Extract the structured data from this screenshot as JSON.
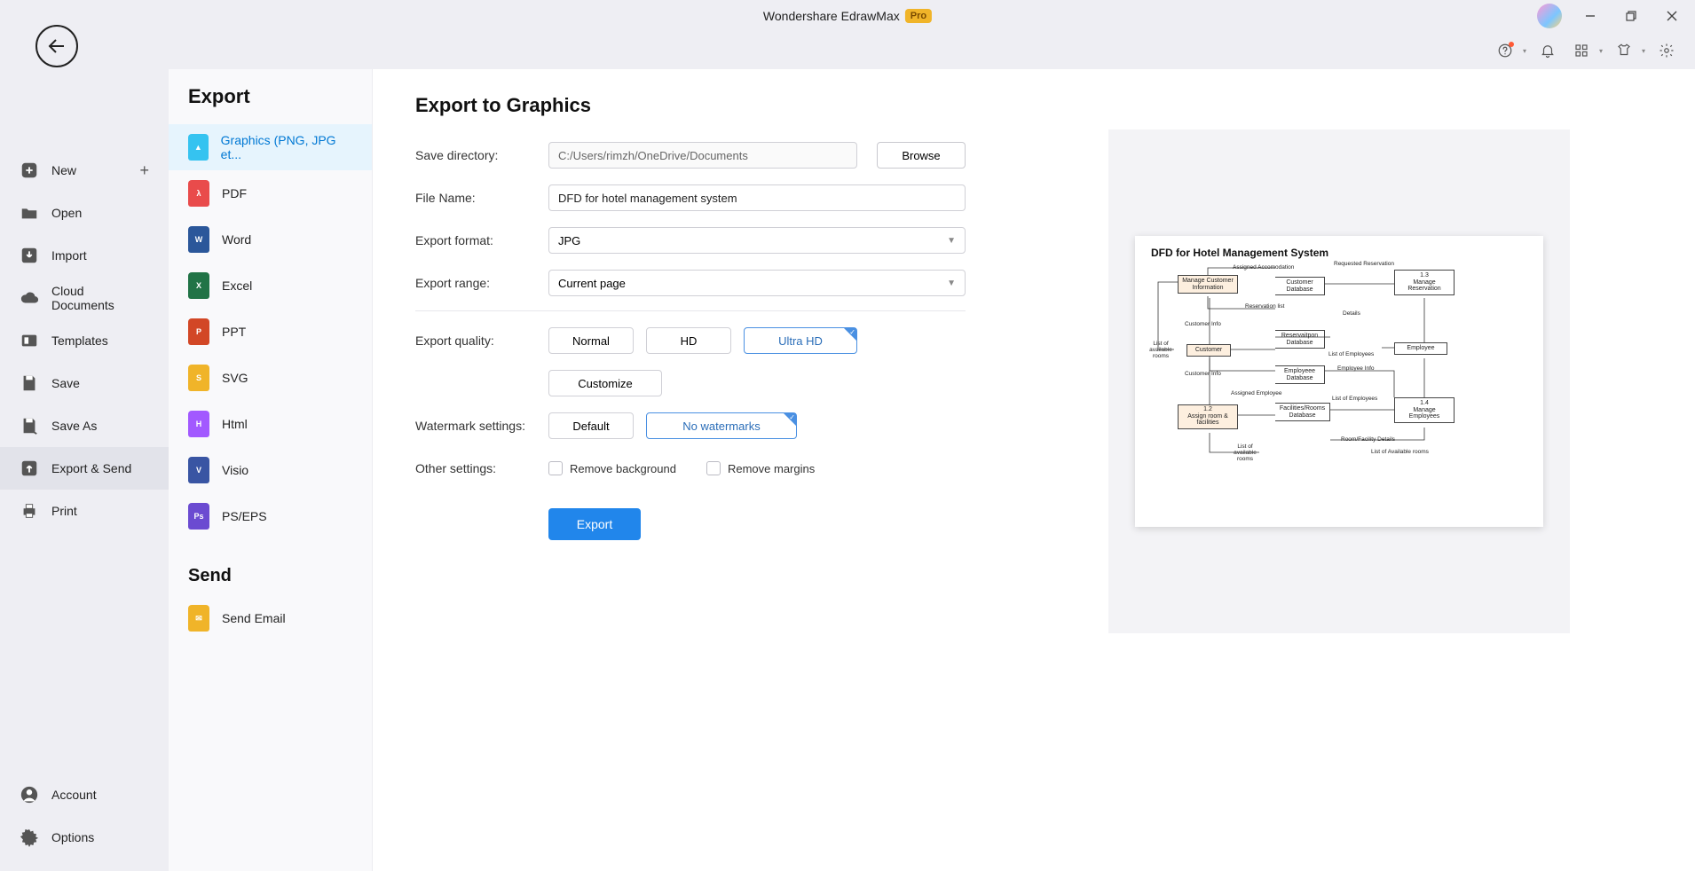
{
  "app": {
    "title": "Wondershare EdrawMax",
    "badge": "Pro"
  },
  "sidenav": {
    "items": [
      {
        "label": "New",
        "hasPlus": true
      },
      {
        "label": "Open"
      },
      {
        "label": "Import"
      },
      {
        "label": "Cloud Documents"
      },
      {
        "label": "Templates"
      },
      {
        "label": "Save"
      },
      {
        "label": "Save As"
      },
      {
        "label": "Export & Send",
        "selected": true
      },
      {
        "label": "Print"
      }
    ],
    "footer": [
      {
        "label": "Account"
      },
      {
        "label": "Options"
      }
    ]
  },
  "formatPanel": {
    "exportTitle": "Export",
    "sendTitle": "Send",
    "items": [
      {
        "label": "Graphics (PNG, JPG et...",
        "color": "#35c3f0",
        "active": true
      },
      {
        "label": "PDF",
        "color": "#e94b4b"
      },
      {
        "label": "Word",
        "color": "#2b579a"
      },
      {
        "label": "Excel",
        "color": "#217346"
      },
      {
        "label": "PPT",
        "color": "#d24726"
      },
      {
        "label": "SVG",
        "color": "#f0b429"
      },
      {
        "label": "Html",
        "color": "#a259ff"
      },
      {
        "label": "Visio",
        "color": "#3955a3"
      },
      {
        "label": "PS/EPS",
        "color": "#6b4bd1"
      }
    ],
    "sendItems": [
      {
        "label": "Send Email",
        "color": "#f0b429"
      }
    ]
  },
  "form": {
    "heading": "Export to Graphics",
    "saveDirLabel": "Save directory:",
    "saveDirPlaceholder": "C:/Users/rimzh/OneDrive/Documents",
    "browseLabel": "Browse",
    "fileNameLabel": "File Name:",
    "fileNameValue": "DFD for hotel management system",
    "formatLabel": "Export format:",
    "formatValue": "JPG",
    "rangeLabel": "Export range:",
    "rangeValue": "Current page",
    "qualityLabel": "Export quality:",
    "qualityOptions": [
      "Normal",
      "HD",
      "Ultra HD"
    ],
    "qualitySelected": "Ultra HD",
    "customizeLabel": "Customize",
    "watermarkLabel": "Watermark settings:",
    "watermarkOptions": [
      "Default",
      "No watermarks"
    ],
    "watermarkSelected": "No watermarks",
    "otherLabel": "Other settings:",
    "removeBg": "Remove background",
    "removeMargins": "Remove margins",
    "exportBtn": "Export"
  },
  "preview": {
    "title": "DFD for Hotel Management System",
    "nodes": {
      "manageCustomer": "Manage Customer Information",
      "customer": "Customer",
      "assignRoom": "Assign room & facilities",
      "p12": "1.2",
      "manageReservation": "Manage Reservation",
      "p13": "1.3",
      "manageEmployees": "Manage Employees",
      "p14": "1.4",
      "customerDb": "Customer Database",
      "reservationDb": "Reservaitpon Database",
      "employeeDb": "Employeee Database",
      "facilitiesDb": "Facilities/Rooms Database",
      "employee": "Employee"
    },
    "edges": {
      "assignedAccom": "Assigned Accomodation",
      "requestedRes": "Requested Reservation",
      "reservationList": "Reservation list",
      "customerInfo1": "Customer Info",
      "customerInfo2": "Customer Info",
      "details": "Details",
      "listEmployees1": "List of Employees",
      "listEmployees2": "List of Employees",
      "employeeInfo": "Employee Info",
      "assignedEmployee": "Assigned Employee",
      "roomFacility": "Room/Facility Details",
      "listAvailRooms1": "List of available rooms",
      "listAvailRooms2": "List of available rooms",
      "listAvailRoomsR": "List of Available rooms"
    }
  }
}
